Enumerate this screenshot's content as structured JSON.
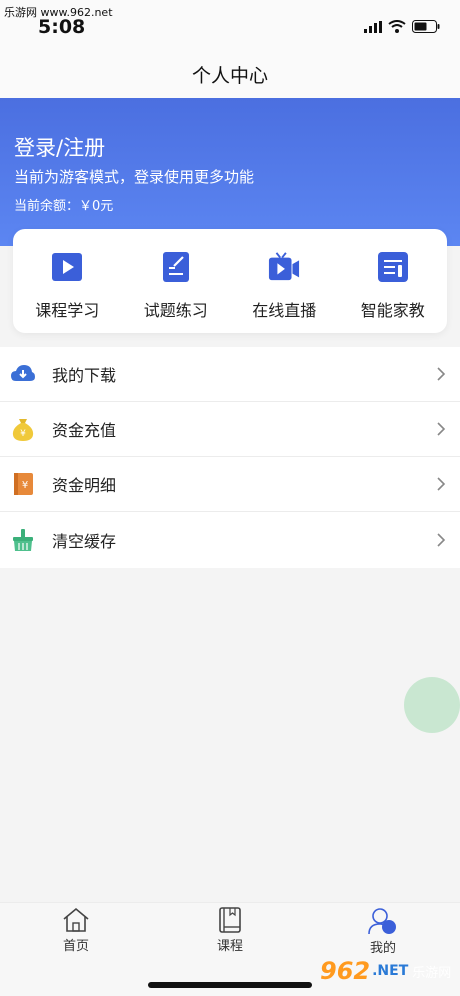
{
  "status_bar": {
    "watermark": "乐游网 www.962.net",
    "time": "5:08"
  },
  "nav": {
    "title": "个人中心"
  },
  "hero": {
    "title": "登录/注册",
    "subtitle": "当前为游客模式，登录使用更多功能",
    "balance": "当前余额：￥0元"
  },
  "quick_actions": [
    {
      "label": "课程学习",
      "icon": "play-video-icon"
    },
    {
      "label": "试题练习",
      "icon": "edit-document-icon"
    },
    {
      "label": "在线直播",
      "icon": "live-camera-icon"
    },
    {
      "label": "智能家教",
      "icon": "tutor-list-icon"
    }
  ],
  "menu": [
    {
      "label": "我的下载",
      "icon": "cloud-download-icon"
    },
    {
      "label": "资金充值",
      "icon": "money-bag-icon"
    },
    {
      "label": "资金明细",
      "icon": "money-book-icon"
    },
    {
      "label": "清空缓存",
      "icon": "broom-icon"
    }
  ],
  "tabs": [
    {
      "label": "首页",
      "icon": "home-icon"
    },
    {
      "label": "课程",
      "icon": "book-icon"
    },
    {
      "label": "我的",
      "icon": "profile-icon"
    }
  ],
  "watermark_bottom": {
    "brand": "962",
    "suffix": ".NET",
    "cn": "乐游网"
  },
  "colors": {
    "hero_top": "#4b6fe0",
    "hero_bottom": "#5c86f2",
    "icon_blue": "#3b5fd9",
    "float_ball": "#c9e7d1"
  }
}
